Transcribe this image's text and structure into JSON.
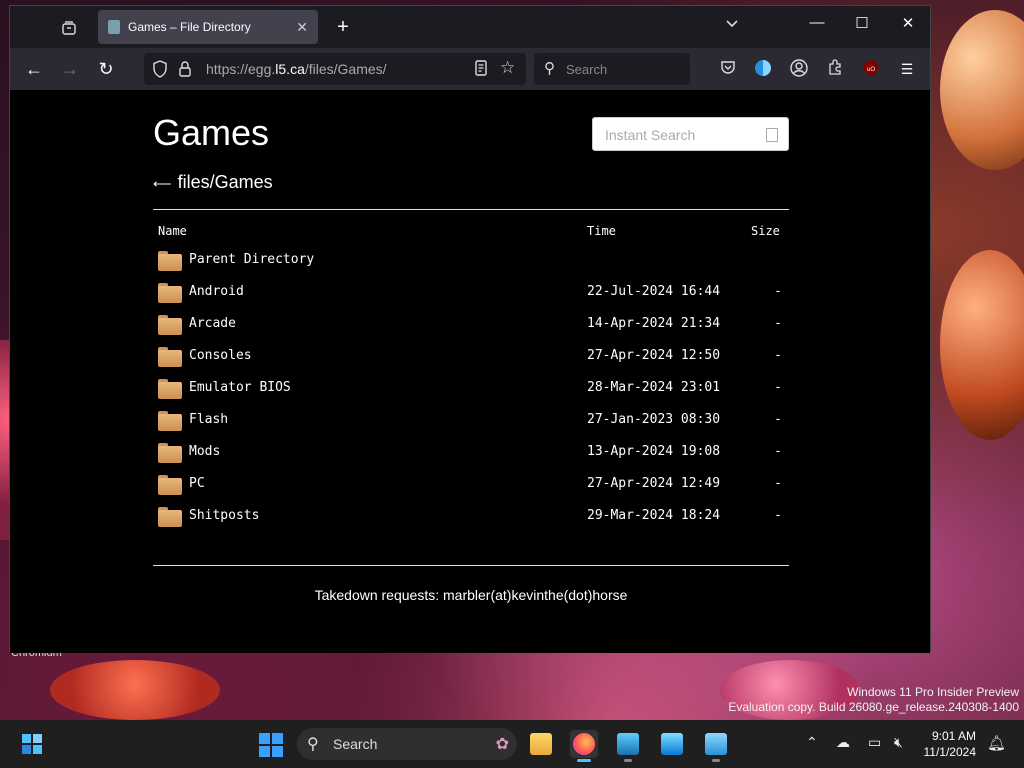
{
  "desktop": {
    "app_label": "Chromium",
    "watermark_line1": "Windows 11 Pro Insider Preview",
    "watermark_line2": "Evaluation copy. Build 26080.ge_release.240308-1400"
  },
  "browser": {
    "tab_title": "Games – File Directory",
    "url_prefix": "https://egg.",
    "url_host": "l5.ca",
    "url_path": "/files/Games/",
    "search_placeholder": "Search"
  },
  "page": {
    "title": "Games",
    "instant_search_placeholder": "Instant Search",
    "breadcrumb_arrow": "⟵",
    "breadcrumb": "files/Games",
    "columns": {
      "name": "Name",
      "time": "Time",
      "size": "Size"
    },
    "rows": [
      {
        "name": "Parent Directory",
        "time": "",
        "size": ""
      },
      {
        "name": "Android",
        "time": "22-Jul-2024 16:44",
        "size": "-"
      },
      {
        "name": "Arcade",
        "time": "14-Apr-2024 21:34",
        "size": "-"
      },
      {
        "name": "Consoles",
        "time": "27-Apr-2024 12:50",
        "size": "-"
      },
      {
        "name": "Emulator BIOS",
        "time": "28-Mar-2024 23:01",
        "size": "-"
      },
      {
        "name": "Flash",
        "time": "27-Jan-2023 08:30",
        "size": "-"
      },
      {
        "name": "Mods",
        "time": "13-Apr-2024 19:08",
        "size": "-"
      },
      {
        "name": "PC",
        "time": "27-Apr-2024 12:49",
        "size": "-"
      },
      {
        "name": "Shitposts",
        "time": "29-Mar-2024 18:24",
        "size": "-"
      }
    ],
    "footer": "Takedown requests: marbler(at)kevinthe(dot)horse"
  },
  "taskbar": {
    "search_label": "Search",
    "time": "9:01 AM",
    "date": "11/1/2024"
  }
}
